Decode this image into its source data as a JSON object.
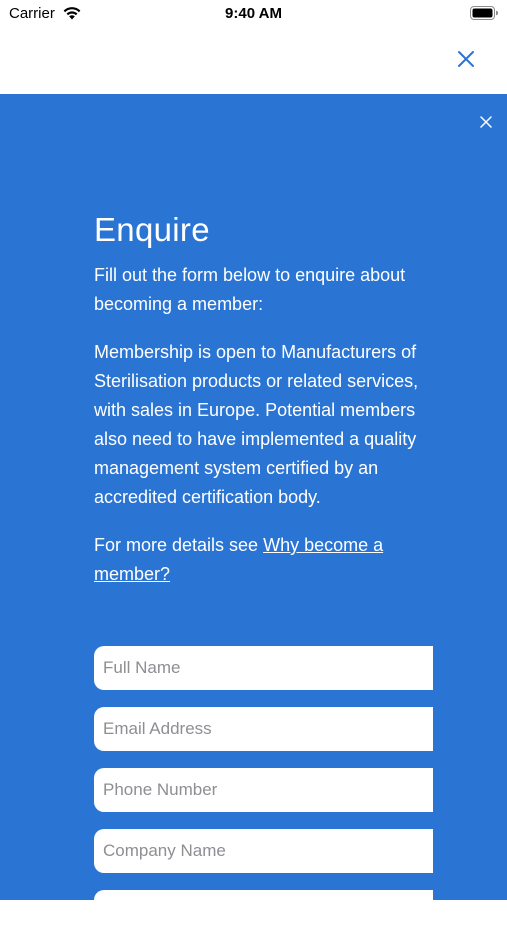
{
  "status_bar": {
    "carrier": "Carrier",
    "time": "9:40 AM"
  },
  "colors": {
    "panel": "#2a74d4",
    "close_icon": "#2a74d4",
    "text_on_panel": "#ffffff"
  },
  "icons": {
    "top_close": "close-icon",
    "panel_close": "close-icon"
  },
  "enquire": {
    "title": "Enquire",
    "intro": "Fill out the form below to enquire about becoming a member:",
    "description": "Membership is open to Manufacturers of Sterilisation products or related services, with sales in Europe. Potential members also need to have implemented a quality management system certified by an accredited certification body.",
    "details_prefix": "For more details see ",
    "details_link": "Why become a member?"
  },
  "form": {
    "full_name_placeholder": "Full Name",
    "email_placeholder": "Email Address",
    "phone_placeholder": "Phone Number",
    "company_placeholder": "Company Name"
  }
}
